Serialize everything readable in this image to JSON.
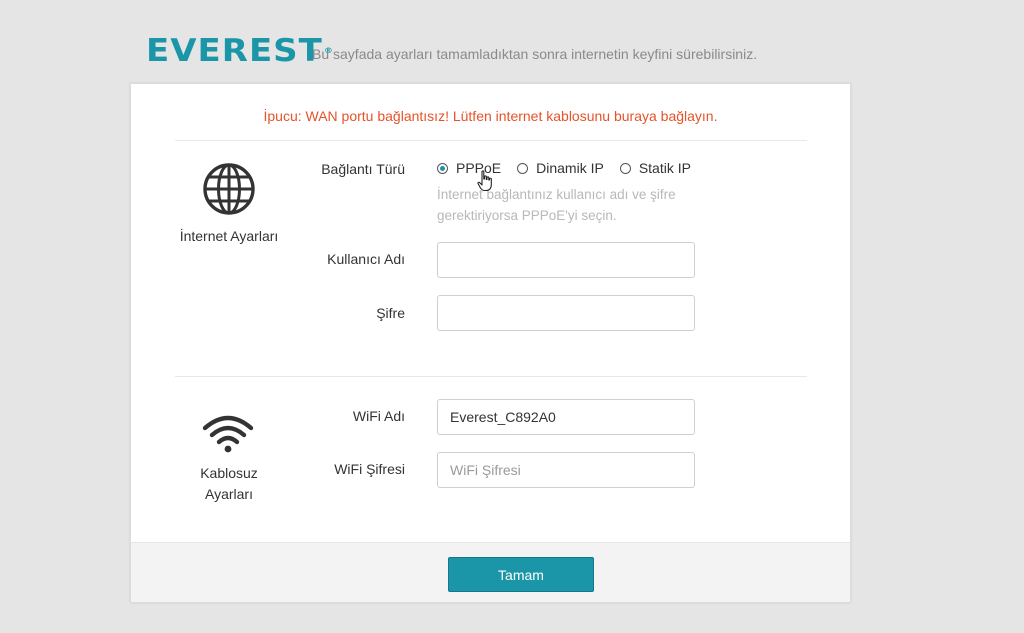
{
  "brand": {
    "logo_text": "EVEREST",
    "logo_mark": "®",
    "tagline": "Bu sayfada ayarları tamamladıktan sonra internetin keyfini sürebilirsiniz.",
    "accent": "#1a96a8"
  },
  "tip": {
    "text": "İpucu: WAN portu bağlantısız! Lütfen internet kablosunu buraya bağlayın.",
    "color": "#e5532a"
  },
  "internet": {
    "section_title": "İnternet Ayarları",
    "icon": "globe-icon",
    "connection_type_label": "Bağlantı Türü",
    "options": [
      {
        "label": "PPPoE",
        "checked": true
      },
      {
        "label": "Dinamik IP",
        "checked": false
      },
      {
        "label": "Statik IP",
        "checked": false
      }
    ],
    "hint": "İnternet bağlantınız kullanıcı adı ve şifre gerektiriyorsa PPPoE'yi seçin.",
    "username_label": "Kullanıcı Adı",
    "username_value": "",
    "password_label": "Şifre",
    "password_value": ""
  },
  "wireless": {
    "section_title": "Kablosuz Ayarları",
    "icon": "wifi-icon",
    "wifi_name_label": "WiFi Adı",
    "wifi_name_value": "Everest_C892A0",
    "wifi_password_label": "WiFi Şifresi",
    "wifi_password_placeholder": "WiFi Şifresi",
    "wifi_password_value": ""
  },
  "footer": {
    "ok_label": "Tamam"
  }
}
